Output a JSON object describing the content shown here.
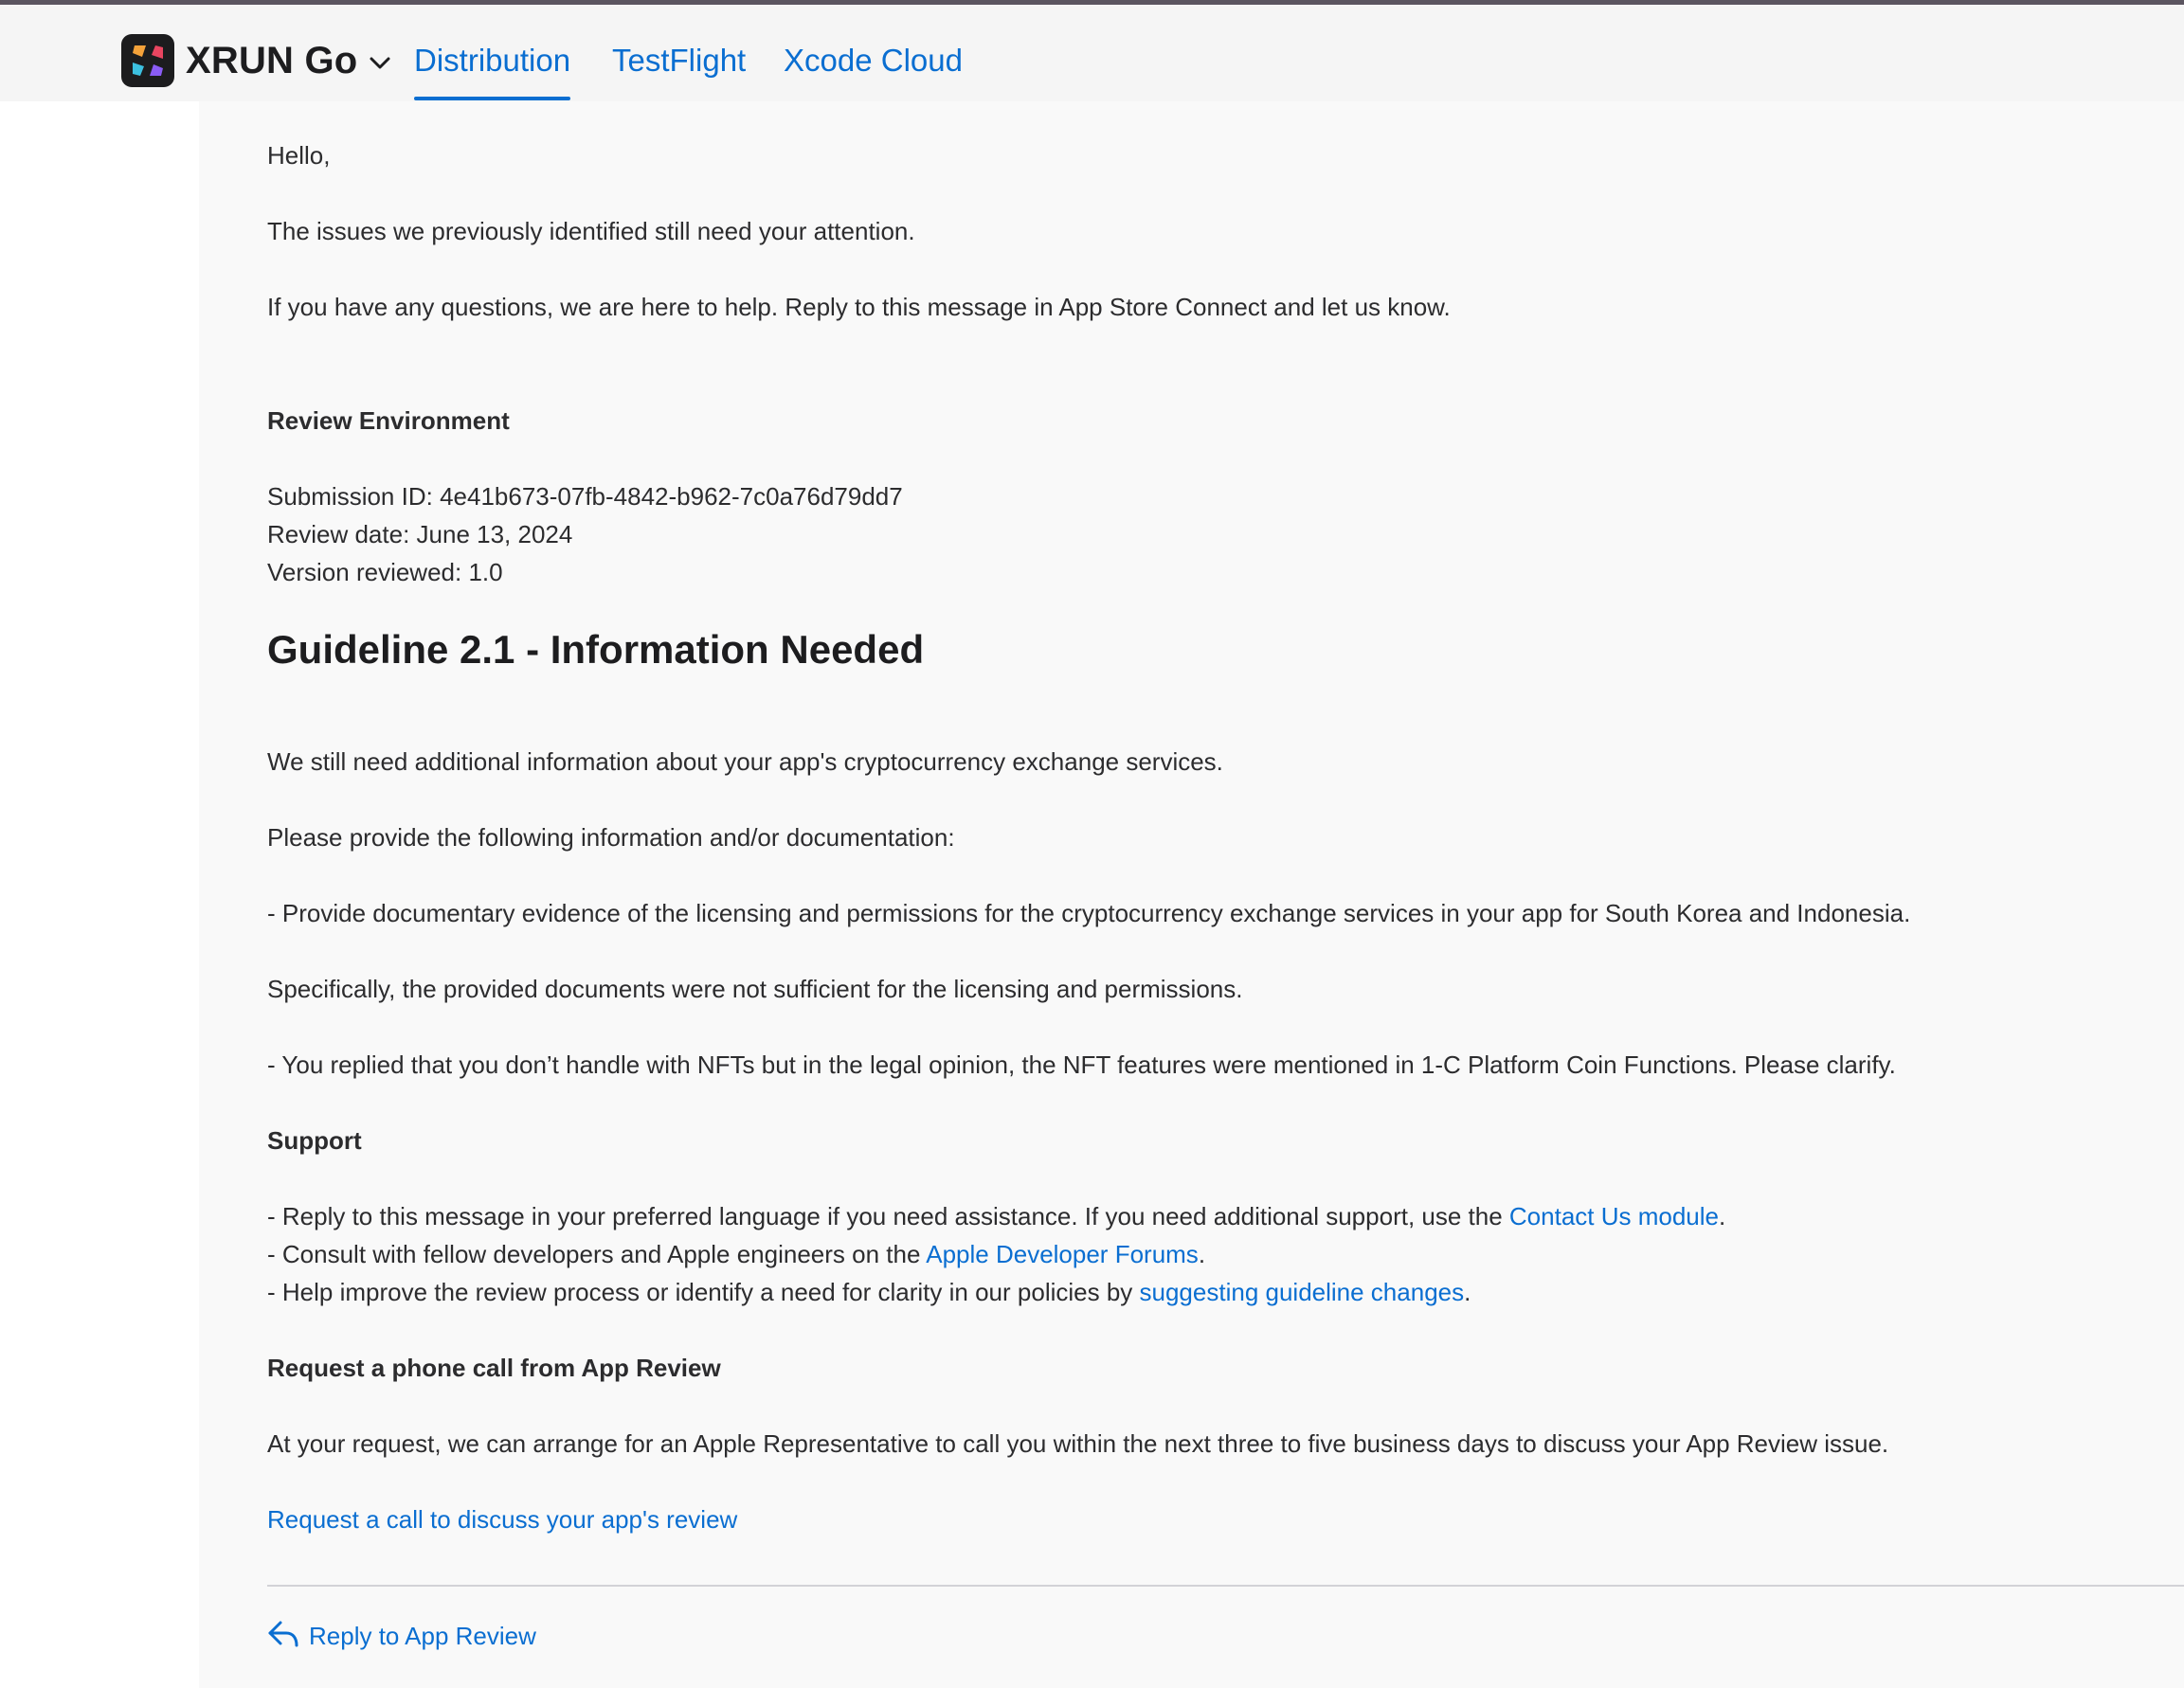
{
  "header": {
    "app_name": "XRUN Go",
    "tabs": [
      {
        "label": "Distribution",
        "active": true
      },
      {
        "label": "TestFlight",
        "active": false
      },
      {
        "label": "Xcode Cloud",
        "active": false
      }
    ]
  },
  "message": {
    "greeting": "Hello,",
    "intro": "The issues we previously identified still need your attention.",
    "help": "If you have any questions, we are here to help. Reply to this message in App Store Connect and let us know.",
    "review_environment_heading": "Review Environment",
    "submission_id": "Submission ID: 4e41b673-07fb-4842-b962-7c0a76d79dd7",
    "review_date": "Review date: June 13, 2024",
    "version_reviewed": "Version reviewed: 1.0",
    "guideline_heading": "Guideline 2.1 - Information Needed",
    "still_need": "We still need additional information about your app's cryptocurrency exchange services.",
    "please_provide": "Please provide the following information and/or documentation:",
    "item_licensing": "- Provide documentary evidence of the licensing and permissions for the cryptocurrency exchange services in your app for South Korea and Indonesia.",
    "specifically": "Specifically, the provided documents were not sufficient for the licensing and permissions.",
    "item_nft": "- You replied that you don’t handle with NFTs but in the legal opinion, the NFT features were mentioned in 1-C Platform Coin Functions. Please clarify.",
    "support_heading": "Support",
    "support_1_text": "- Reply to this message in your preferred language if you need assistance. If you need additional support, use the ",
    "support_1_link": "Contact Us module",
    "support_1_end": ".",
    "support_2_text": "- Consult with fellow developers and Apple engineers on the ",
    "support_2_link": "Apple Developer Forums",
    "support_2_end": ".",
    "support_3_text": "- Help improve the review process or identify a need for clarity in our policies by ",
    "support_3_link": "suggesting guideline changes",
    "support_3_end": ".",
    "phone_heading": "Request a phone call from App Review",
    "phone_text": "At your request, we can arrange for an Apple Representative to call you within the next three to five business days to discuss your App Review issue.",
    "phone_link": "Request a call to discuss your app's review"
  },
  "footer": {
    "reply_label": "Reply to App Review"
  },
  "colors": {
    "link": "#0a6ed1",
    "text": "#2c2c2e",
    "header_bg": "#f5f5f5",
    "content_bg": "#f9f9f9"
  },
  "icons": {
    "app": "xrun-app-icon",
    "switcher": "chevron-down-icon",
    "reply": "reply-arrow-icon"
  }
}
